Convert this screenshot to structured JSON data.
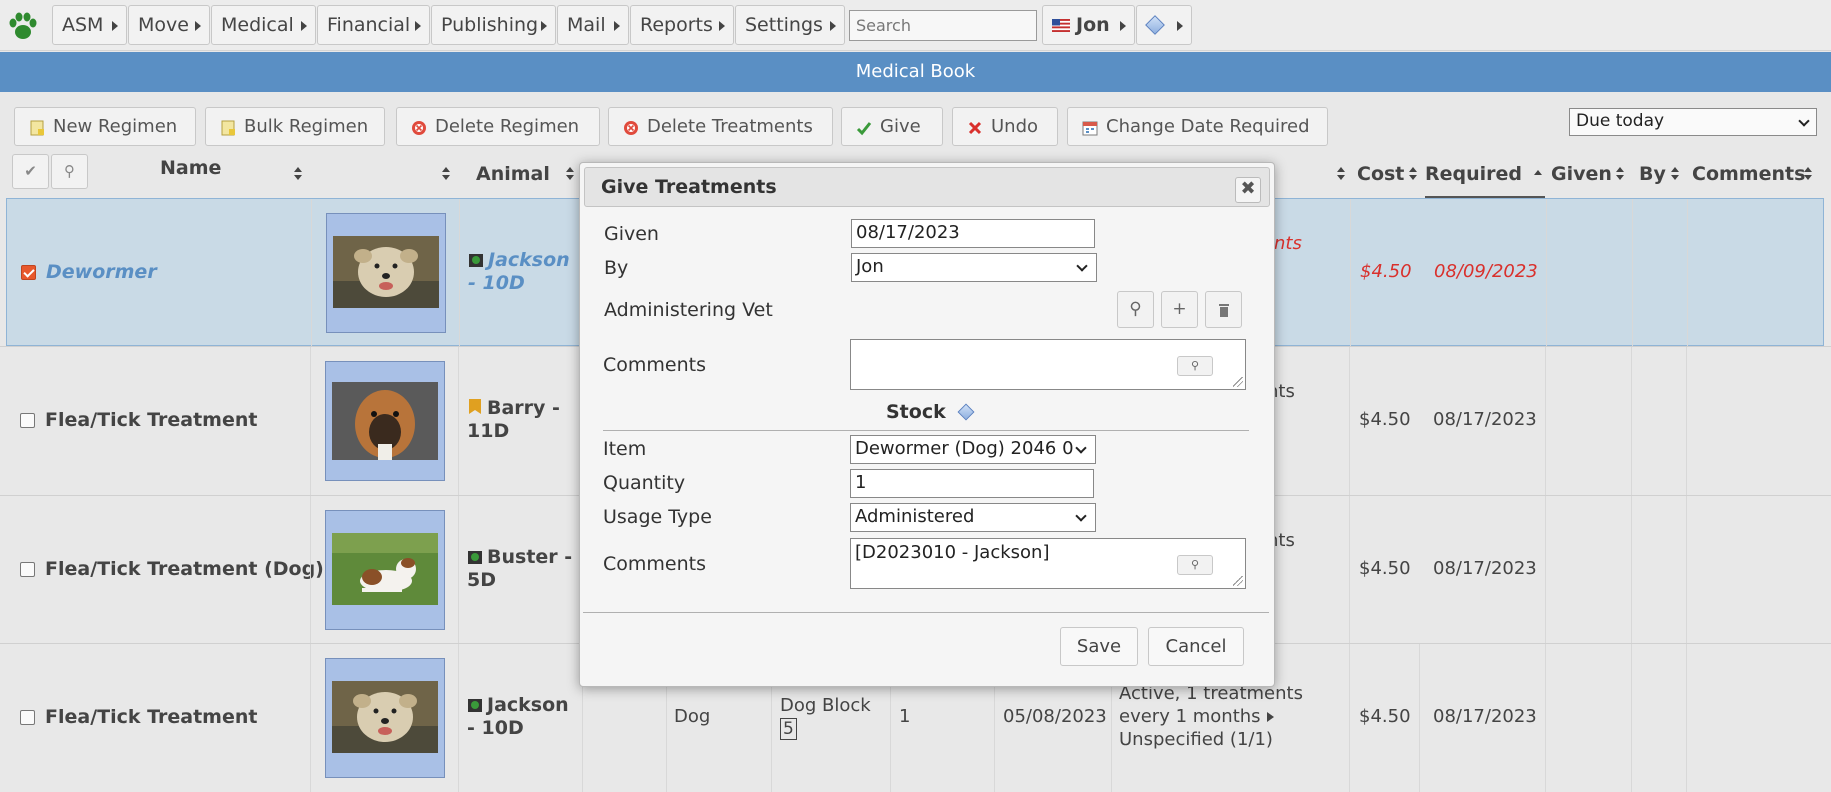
{
  "menu": {
    "items": [
      {
        "label": "ASM"
      },
      {
        "label": "Move"
      },
      {
        "label": "Medical"
      },
      {
        "label": "Financial"
      },
      {
        "label": "Publishing"
      },
      {
        "label": "Mail"
      },
      {
        "label": "Reports"
      },
      {
        "label": "Settings"
      }
    ],
    "search_placeholder": "Search",
    "user": "Jon"
  },
  "title": "Medical Book",
  "toolbar": {
    "new_regimen": "New Regimen",
    "bulk_regimen": "Bulk Regimen",
    "delete_regimen": "Delete Regimen",
    "delete_treatments": "Delete Treatments",
    "give": "Give",
    "undo": "Undo",
    "change_date_required": "Change Date Required",
    "filter_selected": "Due today"
  },
  "table": {
    "headers": {
      "name": "Name",
      "animal": "Animal",
      "cost": "Cost",
      "required": "Required",
      "given": "Given",
      "by": "By",
      "comments": "Comments"
    },
    "rows": [
      {
        "name": "Dewormer",
        "animal": "Jackson - 10D",
        "status_fragment": "nts",
        "cost": "$4.50",
        "required": "08/09/2023",
        "selected": true
      },
      {
        "name": "Flea/Tick Treatment",
        "animal": "Barry - 11D",
        "status_fragment": "nts",
        "cost": "$4.50",
        "required": "08/17/2023",
        "selected": false
      },
      {
        "name": "Flea/Tick Treatment (Dog)",
        "animal": "Buster - 5D",
        "status_fragment": "nts",
        "cost": "$4.50",
        "required": "08/17/2023",
        "selected": false
      },
      {
        "name": "Flea/Tick Treatment",
        "animal": "Jackson - 10D",
        "species": "Dog",
        "location": "Dog Block",
        "unit": "5",
        "dosage": "1",
        "start": "05/08/2023",
        "status_line1": "Active, 1 treatments",
        "status_line2": "every 1 months",
        "status_line3": "Unspecified (1/1)",
        "cost": "$4.50",
        "required": "08/17/2023",
        "selected": false
      }
    ]
  },
  "dialog": {
    "title": "Give Treatments",
    "given_label": "Given",
    "given_value": "08/17/2023",
    "by_label": "By",
    "by_value": "Jon",
    "vet_label": "Administering Vet",
    "comments_label": "Comments",
    "comments_value": "",
    "stock_heading": "Stock",
    "item_label": "Item",
    "item_value": "Dewormer (Dog) 2046 0",
    "quantity_label": "Quantity",
    "quantity_value": "1",
    "usage_label": "Usage Type",
    "usage_value": "Administered",
    "stock_comments_label": "Comments",
    "stock_comments_value": "[D2023010 - Jackson]",
    "save": "Save",
    "cancel": "Cancel"
  }
}
